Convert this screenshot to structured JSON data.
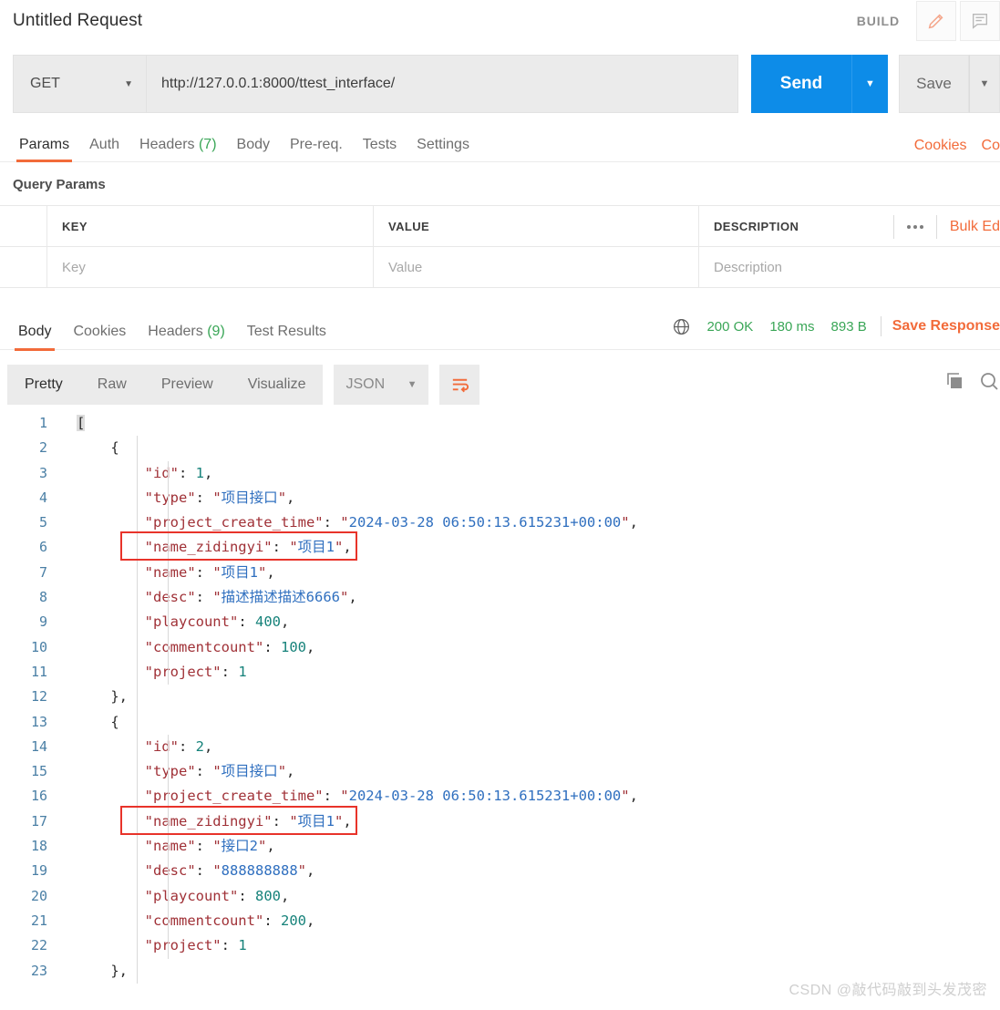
{
  "window": {
    "request_title": "Untitled Request",
    "build_label": "BUILD",
    "edit_icon": "pencil-icon",
    "comment_icon": "comment-icon"
  },
  "url_bar": {
    "method": "GET",
    "url": "http://127.0.0.1:8000/ttest_interface/",
    "send_label": "Send",
    "save_label": "Save",
    "caret": "▼"
  },
  "request_tabs": {
    "items": [
      {
        "label": "Params",
        "count": "",
        "active": true
      },
      {
        "label": "Auth",
        "count": "",
        "active": false
      },
      {
        "label": "Headers",
        "count": "(7)",
        "active": false
      },
      {
        "label": "Body",
        "count": "",
        "active": false
      },
      {
        "label": "Pre-req.",
        "count": "",
        "active": false
      },
      {
        "label": "Tests",
        "count": "",
        "active": false
      },
      {
        "label": "Settings",
        "count": "",
        "active": false
      }
    ],
    "links": [
      {
        "label": "Cookies"
      },
      {
        "label": "Co"
      }
    ]
  },
  "query_params": {
    "section_title": "Query Params",
    "columns": [
      "KEY",
      "VALUE",
      "DESCRIPTION"
    ],
    "placeholders": {
      "key": "Key",
      "value": "Value",
      "description": "Description"
    },
    "more_icon": "ellipsis-icon",
    "bulk_edit_label": "Bulk Ed"
  },
  "response": {
    "tabs": [
      {
        "label": "Body",
        "count": "",
        "active": true
      },
      {
        "label": "Cookies",
        "count": "",
        "active": false
      },
      {
        "label": "Headers",
        "count": "(9)",
        "active": false
      },
      {
        "label": "Test Results",
        "count": "",
        "active": false
      }
    ],
    "globe_icon": "globe-icon",
    "status": "200 OK",
    "time": "180 ms",
    "size": "893 B",
    "save_response_label": "Save Response",
    "toolbar": {
      "views": [
        {
          "label": "Pretty",
          "active": true
        },
        {
          "label": "Raw",
          "active": false
        },
        {
          "label": "Preview",
          "active": false
        },
        {
          "label": "Visualize",
          "active": false
        }
      ],
      "format": "JSON",
      "format_caret": "▼",
      "wrap_icon": "word-wrap-icon",
      "copy_icon": "copy-icon",
      "search_icon": "search-icon"
    },
    "code_lines": [
      {
        "num": "1",
        "indent": 0,
        "tokens": [
          {
            "t": "[",
            "c": "br"
          }
        ]
      },
      {
        "num": "2",
        "indent": 1,
        "tokens": [
          {
            "t": "{",
            "c": "p"
          }
        ]
      },
      {
        "num": "3",
        "indent": 2,
        "tokens": [
          {
            "t": "\"id\"",
            "c": "k"
          },
          {
            "t": ": ",
            "c": "p"
          },
          {
            "t": "1",
            "c": "n"
          },
          {
            "t": ",",
            "c": "p"
          }
        ]
      },
      {
        "num": "4",
        "indent": 2,
        "tokens": [
          {
            "t": "\"type\"",
            "c": "k"
          },
          {
            "t": ": ",
            "c": "p"
          },
          {
            "t": "\"",
            "c": "q"
          },
          {
            "t": "项目接口",
            "c": "s"
          },
          {
            "t": "\"",
            "c": "q"
          },
          {
            "t": ",",
            "c": "p"
          }
        ]
      },
      {
        "num": "5",
        "indent": 2,
        "tokens": [
          {
            "t": "\"project_create_time\"",
            "c": "k"
          },
          {
            "t": ": ",
            "c": "p"
          },
          {
            "t": "\"",
            "c": "q"
          },
          {
            "t": "2024-03-28 06:50:13.615231+00:00",
            "c": "s"
          },
          {
            "t": "\"",
            "c": "q"
          },
          {
            "t": ",",
            "c": "p"
          }
        ]
      },
      {
        "num": "6",
        "indent": 2,
        "tokens": [
          {
            "t": "\"name_zidingyi\"",
            "c": "k"
          },
          {
            "t": ": ",
            "c": "p"
          },
          {
            "t": "\"",
            "c": "q"
          },
          {
            "t": "项目1",
            "c": "s"
          },
          {
            "t": "\"",
            "c": "q"
          },
          {
            "t": ",",
            "c": "p"
          }
        ]
      },
      {
        "num": "7",
        "indent": 2,
        "tokens": [
          {
            "t": "\"name\"",
            "c": "k"
          },
          {
            "t": ": ",
            "c": "p"
          },
          {
            "t": "\"",
            "c": "q"
          },
          {
            "t": "项目1",
            "c": "s"
          },
          {
            "t": "\"",
            "c": "q"
          },
          {
            "t": ",",
            "c": "p"
          }
        ]
      },
      {
        "num": "8",
        "indent": 2,
        "tokens": [
          {
            "t": "\"desc\"",
            "c": "k"
          },
          {
            "t": ": ",
            "c": "p"
          },
          {
            "t": "\"",
            "c": "q"
          },
          {
            "t": "描述描述描述6666",
            "c": "s"
          },
          {
            "t": "\"",
            "c": "q"
          },
          {
            "t": ",",
            "c": "p"
          }
        ]
      },
      {
        "num": "9",
        "indent": 2,
        "tokens": [
          {
            "t": "\"playcount\"",
            "c": "k"
          },
          {
            "t": ": ",
            "c": "p"
          },
          {
            "t": "400",
            "c": "n"
          },
          {
            "t": ",",
            "c": "p"
          }
        ]
      },
      {
        "num": "10",
        "indent": 2,
        "tokens": [
          {
            "t": "\"commentcount\"",
            "c": "k"
          },
          {
            "t": ": ",
            "c": "p"
          },
          {
            "t": "100",
            "c": "n"
          },
          {
            "t": ",",
            "c": "p"
          }
        ]
      },
      {
        "num": "11",
        "indent": 2,
        "tokens": [
          {
            "t": "\"project\"",
            "c": "k"
          },
          {
            "t": ": ",
            "c": "p"
          },
          {
            "t": "1",
            "c": "n"
          }
        ]
      },
      {
        "num": "12",
        "indent": 1,
        "tokens": [
          {
            "t": "},",
            "c": "p"
          }
        ]
      },
      {
        "num": "13",
        "indent": 1,
        "tokens": [
          {
            "t": "{",
            "c": "p"
          }
        ]
      },
      {
        "num": "14",
        "indent": 2,
        "tokens": [
          {
            "t": "\"id\"",
            "c": "k"
          },
          {
            "t": ": ",
            "c": "p"
          },
          {
            "t": "2",
            "c": "n"
          },
          {
            "t": ",",
            "c": "p"
          }
        ]
      },
      {
        "num": "15",
        "indent": 2,
        "tokens": [
          {
            "t": "\"type\"",
            "c": "k"
          },
          {
            "t": ": ",
            "c": "p"
          },
          {
            "t": "\"",
            "c": "q"
          },
          {
            "t": "项目接口",
            "c": "s"
          },
          {
            "t": "\"",
            "c": "q"
          },
          {
            "t": ",",
            "c": "p"
          }
        ]
      },
      {
        "num": "16",
        "indent": 2,
        "tokens": [
          {
            "t": "\"project_create_time\"",
            "c": "k"
          },
          {
            "t": ": ",
            "c": "p"
          },
          {
            "t": "\"",
            "c": "q"
          },
          {
            "t": "2024-03-28 06:50:13.615231+00:00",
            "c": "s"
          },
          {
            "t": "\"",
            "c": "q"
          },
          {
            "t": ",",
            "c": "p"
          }
        ]
      },
      {
        "num": "17",
        "indent": 2,
        "tokens": [
          {
            "t": "\"name_zidingyi\"",
            "c": "k"
          },
          {
            "t": ": ",
            "c": "p"
          },
          {
            "t": "\"",
            "c": "q"
          },
          {
            "t": "项目1",
            "c": "s"
          },
          {
            "t": "\"",
            "c": "q"
          },
          {
            "t": ",",
            "c": "p"
          }
        ]
      },
      {
        "num": "18",
        "indent": 2,
        "tokens": [
          {
            "t": "\"name\"",
            "c": "k"
          },
          {
            "t": ": ",
            "c": "p"
          },
          {
            "t": "\"",
            "c": "q"
          },
          {
            "t": "接口2",
            "c": "s"
          },
          {
            "t": "\"",
            "c": "q"
          },
          {
            "t": ",",
            "c": "p"
          }
        ]
      },
      {
        "num": "19",
        "indent": 2,
        "tokens": [
          {
            "t": "\"desc\"",
            "c": "k"
          },
          {
            "t": ": ",
            "c": "p"
          },
          {
            "t": "\"",
            "c": "q"
          },
          {
            "t": "888888888",
            "c": "s"
          },
          {
            "t": "\"",
            "c": "q"
          },
          {
            "t": ",",
            "c": "p"
          }
        ]
      },
      {
        "num": "20",
        "indent": 2,
        "tokens": [
          {
            "t": "\"playcount\"",
            "c": "k"
          },
          {
            "t": ": ",
            "c": "p"
          },
          {
            "t": "800",
            "c": "n"
          },
          {
            "t": ",",
            "c": "p"
          }
        ]
      },
      {
        "num": "21",
        "indent": 2,
        "tokens": [
          {
            "t": "\"commentcount\"",
            "c": "k"
          },
          {
            "t": ": ",
            "c": "p"
          },
          {
            "t": "200",
            "c": "n"
          },
          {
            "t": ",",
            "c": "p"
          }
        ]
      },
      {
        "num": "22",
        "indent": 2,
        "tokens": [
          {
            "t": "\"project\"",
            "c": "k"
          },
          {
            "t": ": ",
            "c": "p"
          },
          {
            "t": "1",
            "c": "n"
          }
        ]
      },
      {
        "num": "23",
        "indent": 1,
        "tokens": [
          {
            "t": "},",
            "c": "p"
          }
        ]
      }
    ],
    "highlights": [
      {
        "line": 6,
        "label": "name-zidingyi-highlight-1"
      },
      {
        "line": 17,
        "label": "name-zidingyi-highlight-2"
      }
    ]
  },
  "watermark": "CSDN @敲代码敲到头发茂密",
  "colors": {
    "accent_orange": "#f26b3a",
    "send_blue": "#0d8ce8",
    "status_green": "#3aa657",
    "highlight_red": "#e8332a"
  }
}
